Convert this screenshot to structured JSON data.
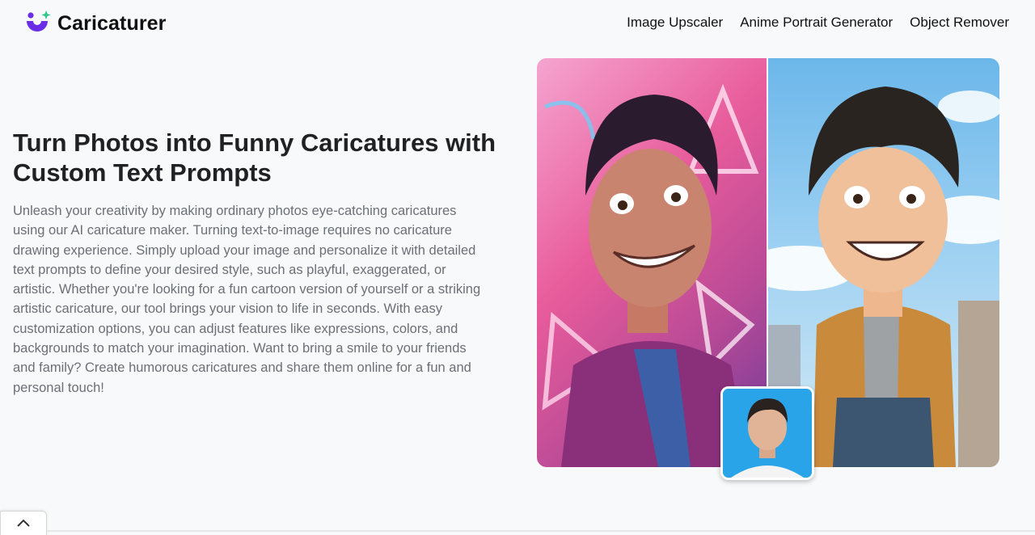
{
  "header": {
    "brand": "Caricaturer",
    "nav": [
      {
        "label": "Image Upscaler"
      },
      {
        "label": "Anime Portrait Generator"
      },
      {
        "label": "Object Remover"
      }
    ]
  },
  "hero": {
    "title": "Turn Photos into Funny Caricatures with Custom Text Prompts",
    "description": "Unleash your creativity by making ordinary photos eye-catching caricatures using our AI caricature maker. Turning text-to-image requires no caricature drawing experience. Simply upload your image and personalize it with detailed text prompts to define your desired style, such as playful, exaggerated, or artistic. Whether you're looking for a fun cartoon version of yourself or a striking artistic caricature, our tool brings your vision to life in seconds. With easy customization options, you can adjust features like expressions, colors, and backgrounds to match your imagination. Want to bring a smile to your friends and family? Create humorous caricatures and share them online for a fun and personal touch!"
  },
  "colors": {
    "accent_purple": "#6a2ee8",
    "accent_green": "#2ec98a",
    "text_primary": "#1f2125",
    "text_secondary": "#6b6f76"
  },
  "icons": {
    "logo": "caricaturer-logo-icon",
    "back_to_top": "chevron-up-icon"
  }
}
